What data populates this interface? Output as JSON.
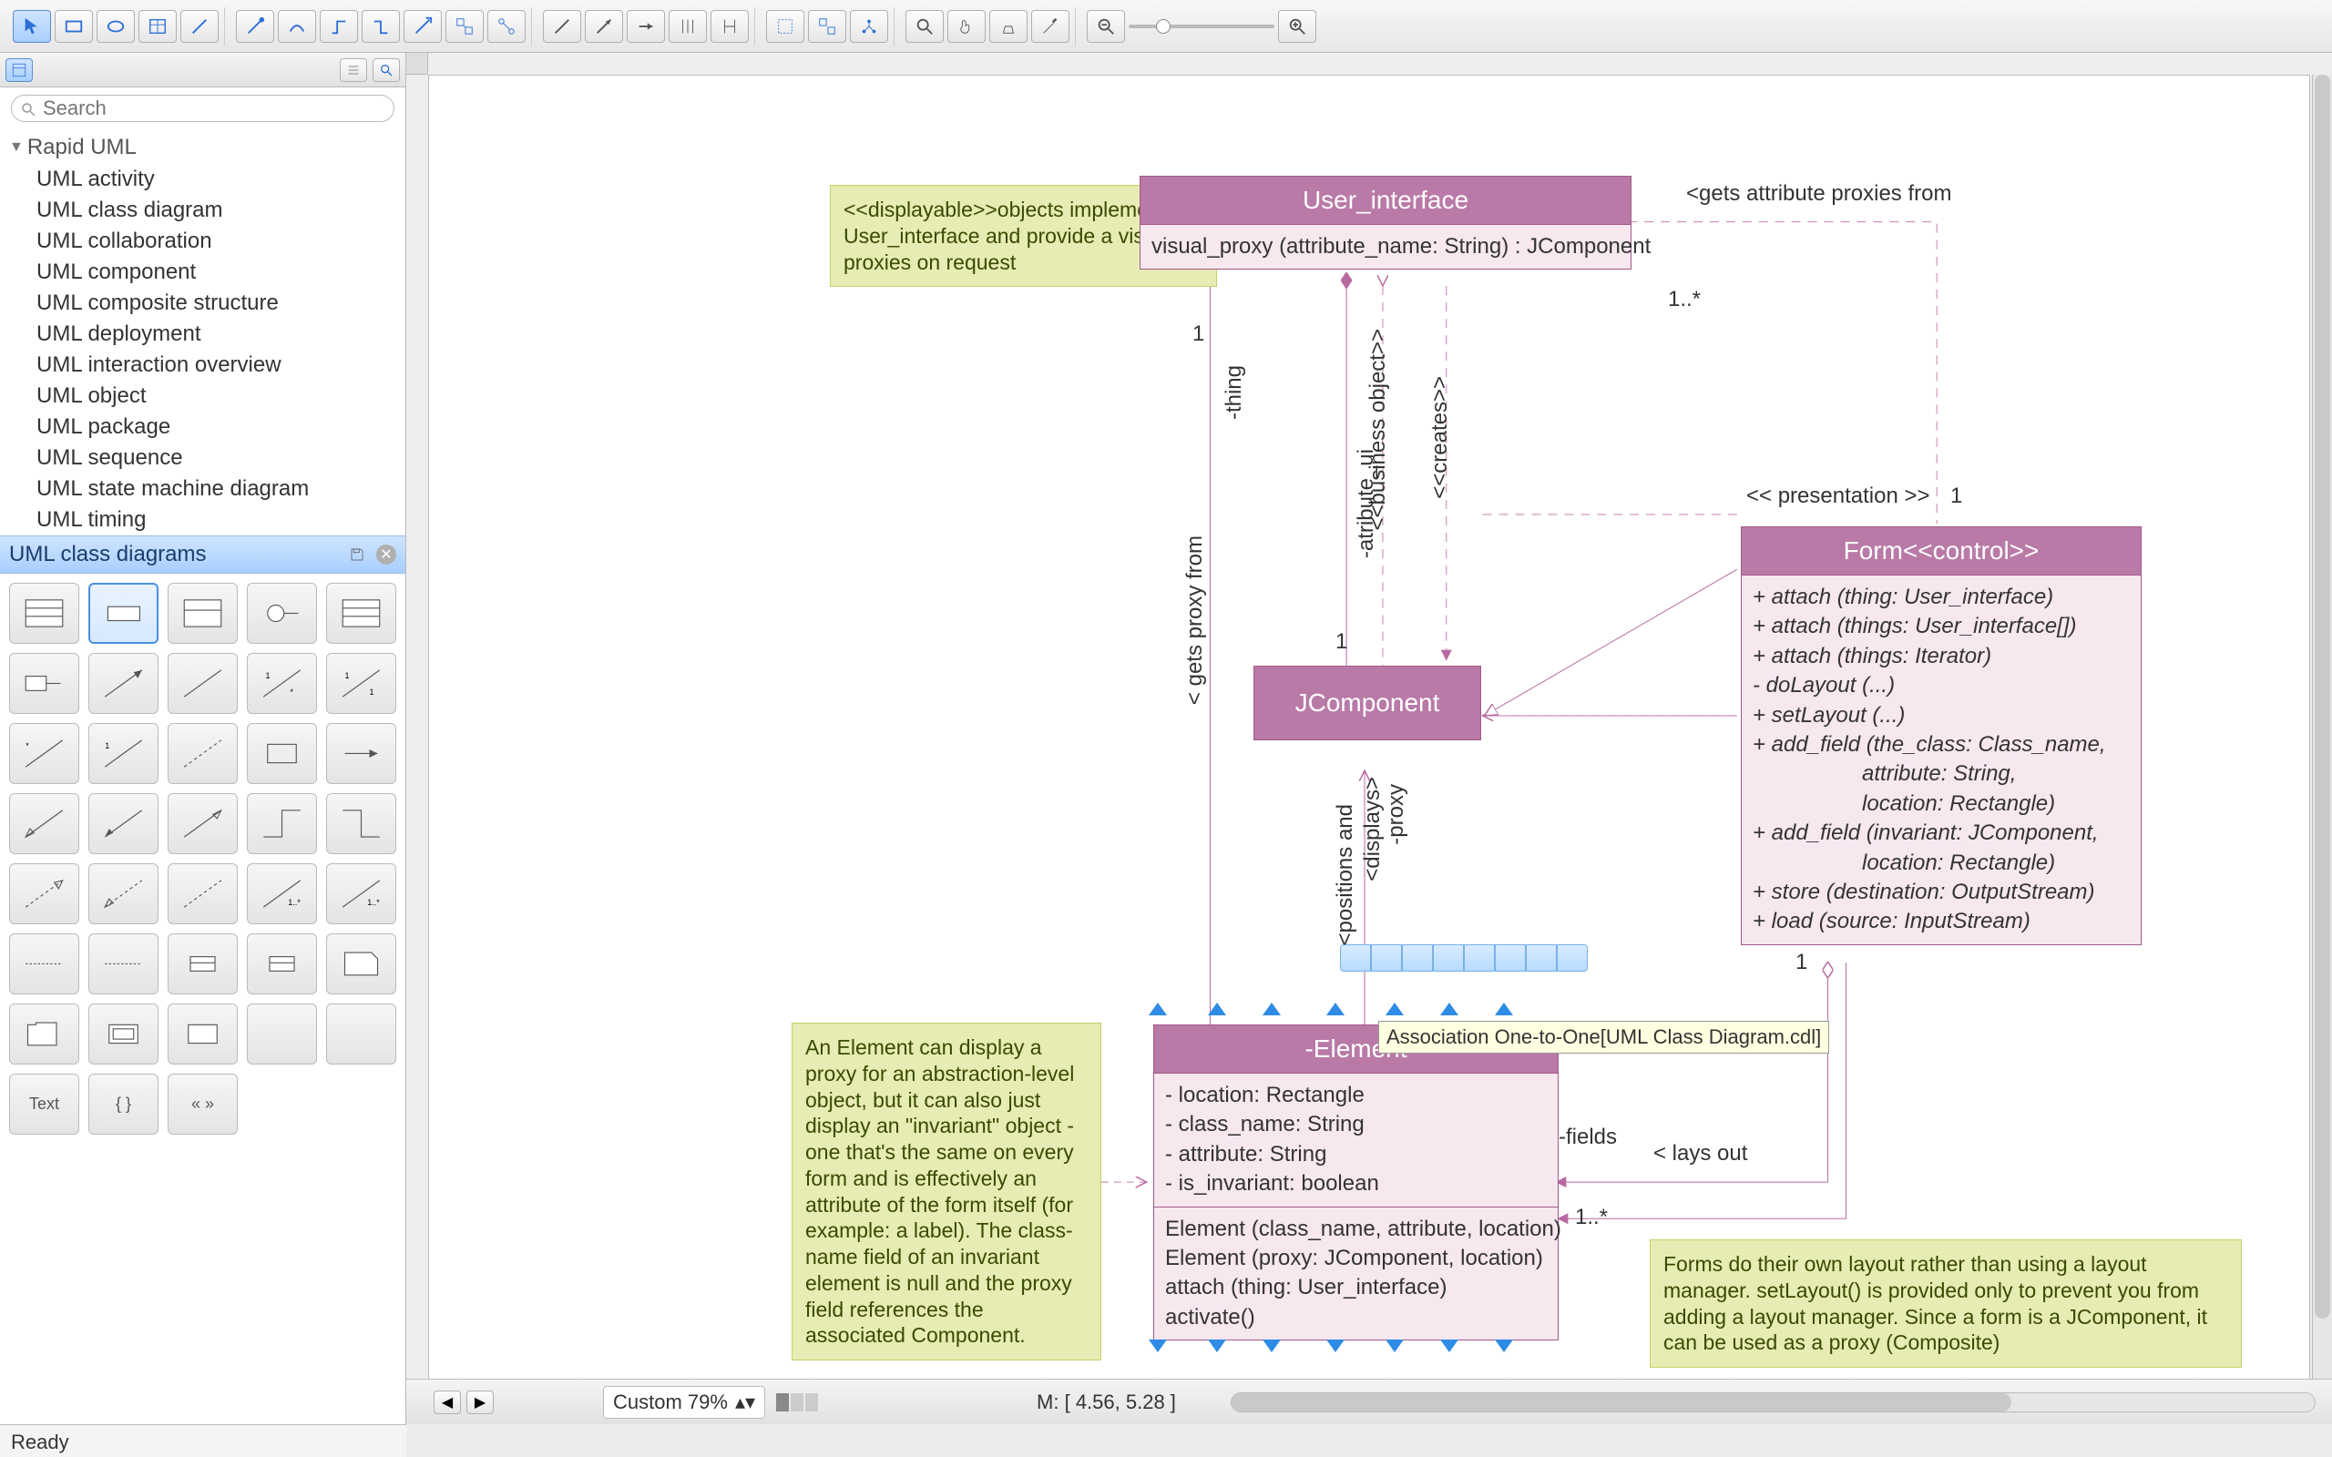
{
  "search": {
    "placeholder": "Search"
  },
  "tree": {
    "header": "Rapid UML",
    "items": [
      "UML activity",
      "UML class diagram",
      "UML collaboration",
      "UML component",
      "UML composite structure",
      "UML deployment",
      "UML interaction overview",
      "UML object",
      "UML package",
      "UML sequence",
      "UML state machine diagram",
      "UML timing"
    ]
  },
  "palette": {
    "title": "UML class diagrams"
  },
  "palette_text_item": "Text",
  "diagram": {
    "notes": {
      "displayable": "<<displayable>>objects implement User_interface and provide a visual proxies on request",
      "element": "An Element can display a proxy for an abstraction-level object, but it can also just display an \"invariant\" object - one that's the same on every form and is effectively an attribute of the form itself (for example: a label). The class-name field of an invariant element is null and the proxy field references the associated Component.",
      "form": "Forms do their own layout rather than using a layout manager. setLayout() is provided only to prevent you from adding a layout manager.\nSince a form is a JComponent, it can be used as a proxy (Composite)"
    },
    "user_interface": {
      "title": "User_interface",
      "op": "visual_proxy (attribute_name: String) : JComponent"
    },
    "jcomponent": {
      "title": "JComponent"
    },
    "form": {
      "title": "Form<<control>>",
      "ops": "+ attach (thing: User_interface)\n+ attach (things: User_interface[])\n+ attach (things: Iterator)\n- doLayout (...)\n+ setLayout (...)\n+ add_field (the_class: Class_name,\n                  attribute: String,\n                  location: Rectangle)\n+ add_field (invariant: JComponent,\n                  location: Rectangle)\n+ store (destination: OutputStream)\n+ load (source: InputStream)"
    },
    "element": {
      "title": "-Element",
      "attrs": "- location: Rectangle\n- class_name: String\n- attribute: String\n- is_invariant: boolean",
      "ops": "Element (class_name, attribute, location)\nElement (proxy: JComponent, location)\nattach (thing: User_interface)\nactivate()"
    },
    "labels": {
      "gets_attr": "<gets attribute proxies from",
      "one_star_a": "1..*",
      "business": "<<business object>>",
      "creates": "<<creates>>",
      "thing": "-thing",
      "one_a": "1",
      "gets_proxy": "< gets proxy from",
      "atribute_ui": "-atribute_ui",
      "one_b": "1",
      "displays": "<displays>",
      "proxy": "-proxy",
      "positions": "<positions and",
      "presentation": "<< presentation >>",
      "one_c": "1",
      "one_d": "1",
      "fields": "-fields",
      "lays_out": "< lays out",
      "one_star_b": "1..*"
    },
    "tooltip": "Association One-to-One[UML Class Diagram.cdl]"
  },
  "bottom": {
    "zoom": "Custom 79%",
    "mouse": "M: [ 4.56, 5.28 ]"
  },
  "status": "Ready"
}
